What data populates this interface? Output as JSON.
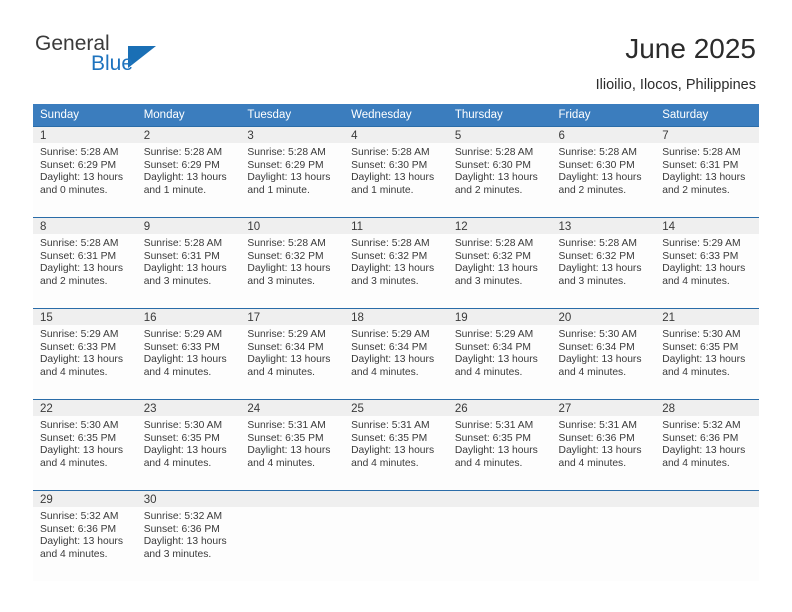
{
  "brand": {
    "name_part1": "General",
    "name_part2": "Blue",
    "triangle_icon": "blue-triangle-icon",
    "color_dark": "#3b3b3b",
    "color_blue": "#1e73be"
  },
  "header": {
    "title": "June 2025",
    "subtitle": "Ilioilio, Ilocos, Philippines"
  },
  "theme": {
    "header_row_bg": "#3b7dbe",
    "week_divider": "#2a6ca8",
    "daynum_strip_bg": "#efefef",
    "cell_bg": "#fdfdfd",
    "text": "#3a3a3a"
  },
  "calendar": {
    "weekday_headers": [
      "Sunday",
      "Monday",
      "Tuesday",
      "Wednesday",
      "Thursday",
      "Friday",
      "Saturday"
    ],
    "labels": {
      "sunrise": "Sunrise:",
      "sunset": "Sunset:",
      "daylight": "Daylight:"
    },
    "weeks": [
      [
        {
          "day": "1",
          "sunrise": "Sunrise: 5:28 AM",
          "sunset": "Sunset: 6:29 PM",
          "daylight_line1": "Daylight: 13 hours",
          "daylight_line2": "and 0 minutes."
        },
        {
          "day": "2",
          "sunrise": "Sunrise: 5:28 AM",
          "sunset": "Sunset: 6:29 PM",
          "daylight_line1": "Daylight: 13 hours",
          "daylight_line2": "and 1 minute."
        },
        {
          "day": "3",
          "sunrise": "Sunrise: 5:28 AM",
          "sunset": "Sunset: 6:29 PM",
          "daylight_line1": "Daylight: 13 hours",
          "daylight_line2": "and 1 minute."
        },
        {
          "day": "4",
          "sunrise": "Sunrise: 5:28 AM",
          "sunset": "Sunset: 6:30 PM",
          "daylight_line1": "Daylight: 13 hours",
          "daylight_line2": "and 1 minute."
        },
        {
          "day": "5",
          "sunrise": "Sunrise: 5:28 AM",
          "sunset": "Sunset: 6:30 PM",
          "daylight_line1": "Daylight: 13 hours",
          "daylight_line2": "and 2 minutes."
        },
        {
          "day": "6",
          "sunrise": "Sunrise: 5:28 AM",
          "sunset": "Sunset: 6:30 PM",
          "daylight_line1": "Daylight: 13 hours",
          "daylight_line2": "and 2 minutes."
        },
        {
          "day": "7",
          "sunrise": "Sunrise: 5:28 AM",
          "sunset": "Sunset: 6:31 PM",
          "daylight_line1": "Daylight: 13 hours",
          "daylight_line2": "and 2 minutes."
        }
      ],
      [
        {
          "day": "8",
          "sunrise": "Sunrise: 5:28 AM",
          "sunset": "Sunset: 6:31 PM",
          "daylight_line1": "Daylight: 13 hours",
          "daylight_line2": "and 2 minutes."
        },
        {
          "day": "9",
          "sunrise": "Sunrise: 5:28 AM",
          "sunset": "Sunset: 6:31 PM",
          "daylight_line1": "Daylight: 13 hours",
          "daylight_line2": "and 3 minutes."
        },
        {
          "day": "10",
          "sunrise": "Sunrise: 5:28 AM",
          "sunset": "Sunset: 6:32 PM",
          "daylight_line1": "Daylight: 13 hours",
          "daylight_line2": "and 3 minutes."
        },
        {
          "day": "11",
          "sunrise": "Sunrise: 5:28 AM",
          "sunset": "Sunset: 6:32 PM",
          "daylight_line1": "Daylight: 13 hours",
          "daylight_line2": "and 3 minutes."
        },
        {
          "day": "12",
          "sunrise": "Sunrise: 5:28 AM",
          "sunset": "Sunset: 6:32 PM",
          "daylight_line1": "Daylight: 13 hours",
          "daylight_line2": "and 3 minutes."
        },
        {
          "day": "13",
          "sunrise": "Sunrise: 5:28 AM",
          "sunset": "Sunset: 6:32 PM",
          "daylight_line1": "Daylight: 13 hours",
          "daylight_line2": "and 3 minutes."
        },
        {
          "day": "14",
          "sunrise": "Sunrise: 5:29 AM",
          "sunset": "Sunset: 6:33 PM",
          "daylight_line1": "Daylight: 13 hours",
          "daylight_line2": "and 4 minutes."
        }
      ],
      [
        {
          "day": "15",
          "sunrise": "Sunrise: 5:29 AM",
          "sunset": "Sunset: 6:33 PM",
          "daylight_line1": "Daylight: 13 hours",
          "daylight_line2": "and 4 minutes."
        },
        {
          "day": "16",
          "sunrise": "Sunrise: 5:29 AM",
          "sunset": "Sunset: 6:33 PM",
          "daylight_line1": "Daylight: 13 hours",
          "daylight_line2": "and 4 minutes."
        },
        {
          "day": "17",
          "sunrise": "Sunrise: 5:29 AM",
          "sunset": "Sunset: 6:34 PM",
          "daylight_line1": "Daylight: 13 hours",
          "daylight_line2": "and 4 minutes."
        },
        {
          "day": "18",
          "sunrise": "Sunrise: 5:29 AM",
          "sunset": "Sunset: 6:34 PM",
          "daylight_line1": "Daylight: 13 hours",
          "daylight_line2": "and 4 minutes."
        },
        {
          "day": "19",
          "sunrise": "Sunrise: 5:29 AM",
          "sunset": "Sunset: 6:34 PM",
          "daylight_line1": "Daylight: 13 hours",
          "daylight_line2": "and 4 minutes."
        },
        {
          "day": "20",
          "sunrise": "Sunrise: 5:30 AM",
          "sunset": "Sunset: 6:34 PM",
          "daylight_line1": "Daylight: 13 hours",
          "daylight_line2": "and 4 minutes."
        },
        {
          "day": "21",
          "sunrise": "Sunrise: 5:30 AM",
          "sunset": "Sunset: 6:35 PM",
          "daylight_line1": "Daylight: 13 hours",
          "daylight_line2": "and 4 minutes."
        }
      ],
      [
        {
          "day": "22",
          "sunrise": "Sunrise: 5:30 AM",
          "sunset": "Sunset: 6:35 PM",
          "daylight_line1": "Daylight: 13 hours",
          "daylight_line2": "and 4 minutes."
        },
        {
          "day": "23",
          "sunrise": "Sunrise: 5:30 AM",
          "sunset": "Sunset: 6:35 PM",
          "daylight_line1": "Daylight: 13 hours",
          "daylight_line2": "and 4 minutes."
        },
        {
          "day": "24",
          "sunrise": "Sunrise: 5:31 AM",
          "sunset": "Sunset: 6:35 PM",
          "daylight_line1": "Daylight: 13 hours",
          "daylight_line2": "and 4 minutes."
        },
        {
          "day": "25",
          "sunrise": "Sunrise: 5:31 AM",
          "sunset": "Sunset: 6:35 PM",
          "daylight_line1": "Daylight: 13 hours",
          "daylight_line2": "and 4 minutes."
        },
        {
          "day": "26",
          "sunrise": "Sunrise: 5:31 AM",
          "sunset": "Sunset: 6:35 PM",
          "daylight_line1": "Daylight: 13 hours",
          "daylight_line2": "and 4 minutes."
        },
        {
          "day": "27",
          "sunrise": "Sunrise: 5:31 AM",
          "sunset": "Sunset: 6:36 PM",
          "daylight_line1": "Daylight: 13 hours",
          "daylight_line2": "and 4 minutes."
        },
        {
          "day": "28",
          "sunrise": "Sunrise: 5:32 AM",
          "sunset": "Sunset: 6:36 PM",
          "daylight_line1": "Daylight: 13 hours",
          "daylight_line2": "and 4 minutes."
        }
      ],
      [
        {
          "day": "29",
          "sunrise": "Sunrise: 5:32 AM",
          "sunset": "Sunset: 6:36 PM",
          "daylight_line1": "Daylight: 13 hours",
          "daylight_line2": "and 4 minutes."
        },
        {
          "day": "30",
          "sunrise": "Sunrise: 5:32 AM",
          "sunset": "Sunset: 6:36 PM",
          "daylight_line1": "Daylight: 13 hours",
          "daylight_line2": "and 3 minutes."
        },
        {
          "day": "",
          "sunrise": "",
          "sunset": "",
          "daylight_line1": "",
          "daylight_line2": ""
        },
        {
          "day": "",
          "sunrise": "",
          "sunset": "",
          "daylight_line1": "",
          "daylight_line2": ""
        },
        {
          "day": "",
          "sunrise": "",
          "sunset": "",
          "daylight_line1": "",
          "daylight_line2": ""
        },
        {
          "day": "",
          "sunrise": "",
          "sunset": "",
          "daylight_line1": "",
          "daylight_line2": ""
        },
        {
          "day": "",
          "sunrise": "",
          "sunset": "",
          "daylight_line1": "",
          "daylight_line2": ""
        }
      ]
    ]
  }
}
